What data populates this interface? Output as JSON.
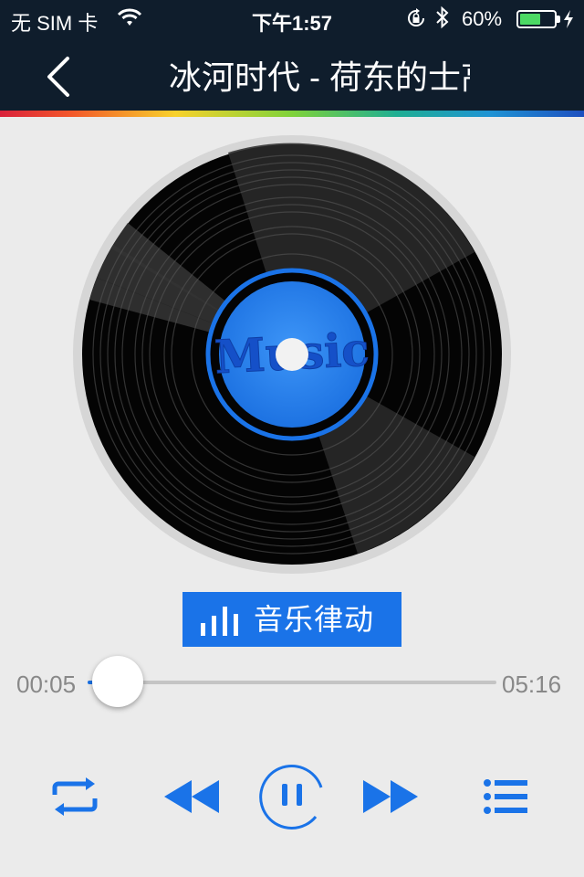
{
  "status_bar": {
    "carrier": "无 SIM 卡",
    "time": "下午1:57",
    "battery_percent": "60%",
    "battery_level": 0.6,
    "icons": [
      "wifi-icon",
      "orientation-lock-icon",
      "bluetooth-icon",
      "battery-icon",
      "charging-icon"
    ]
  },
  "header": {
    "title": "冰河时代 - 荷东的士高",
    "back_icon": "chevron-left-icon"
  },
  "disc": {
    "label_text": "Music"
  },
  "visualizer_button": {
    "label": "音乐律动",
    "icon": "equalizer-bars-icon"
  },
  "progress": {
    "elapsed": "00:05",
    "total": "05:16",
    "fraction": 0.016
  },
  "controls": {
    "repeat": "repeat-icon",
    "previous": "rewind-icon",
    "play_pause": "pause-icon",
    "next": "fast-forward-icon",
    "playlist": "playlist-icon"
  },
  "colors": {
    "accent": "#1a73e8",
    "header_bg": "#0f1d2c",
    "page_bg": "#ebebeb"
  }
}
